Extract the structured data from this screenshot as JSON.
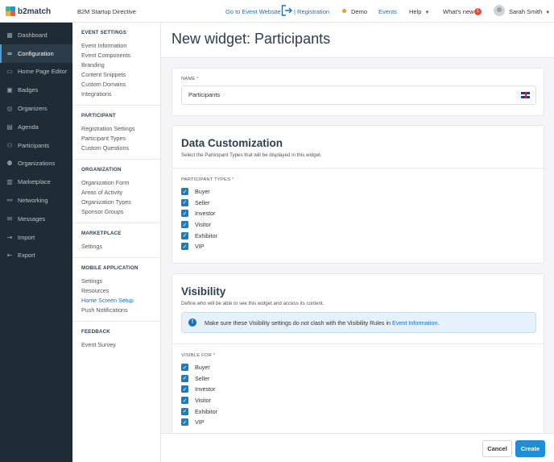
{
  "app": {
    "name": "b2match",
    "event_name": "B2M Startup Directive"
  },
  "topbar": {
    "goto_event": "Go to Event Website",
    "registration": "| Registration",
    "demo": "Demo",
    "events": "Events",
    "help": "Help",
    "whats_new": "What's new",
    "whats_new_count": "1",
    "user_name": "Sarah Smith"
  },
  "sidebar": {
    "items": [
      {
        "label": "Dashboard",
        "icon": "dashboard-icon"
      },
      {
        "label": "Configuration",
        "icon": "link-icon",
        "active": true
      },
      {
        "label": "Home Page Editor",
        "icon": "edit-icon"
      },
      {
        "label": "Badges",
        "icon": "badge-icon"
      },
      {
        "label": "Organizers",
        "icon": "organizers-icon"
      },
      {
        "label": "Agenda",
        "icon": "calendar-icon"
      },
      {
        "label": "Participants",
        "icon": "users-icon"
      },
      {
        "label": "Organizations",
        "icon": "organizations-icon"
      },
      {
        "label": "Marketplace",
        "icon": "marketplace-icon"
      },
      {
        "label": "Networking",
        "icon": "handshake-icon"
      },
      {
        "label": "Messages",
        "icon": "mail-icon"
      },
      {
        "label": "Import",
        "icon": "import-icon"
      },
      {
        "label": "Export",
        "icon": "export-icon"
      }
    ]
  },
  "submenu": {
    "sections": [
      {
        "title": "EVENT SETTINGS",
        "links": [
          "Event Information",
          "Event Components",
          "Branding",
          "Content Snippets",
          "Custom Domains",
          "Integrations"
        ]
      },
      {
        "title": "PARTICIPANT",
        "links": [
          "Registration Settings",
          "Participant Types",
          "Custom Questions"
        ]
      },
      {
        "title": "ORGANIZATION",
        "links": [
          "Organization Form",
          "Areas of Activity",
          "Organization Types",
          "Sponsor Groups"
        ]
      },
      {
        "title": "MARKETPLACE",
        "links": [
          "Settings"
        ]
      },
      {
        "title": "MOBILE APPLICATION",
        "links": [
          "Settings",
          "Resources",
          "Home Screen Setup",
          "Push Notifications"
        ]
      },
      {
        "title": "FEEDBACK",
        "links": [
          "Event Survey"
        ]
      }
    ]
  },
  "main": {
    "title": "New widget: Participants",
    "name_label": "NAME",
    "name_value": "Participants",
    "data_customization": {
      "title": "Data Customization",
      "description": "Select the Participant Types that will be displayed in this widget.",
      "types_label": "PARTICIPANT TYPES",
      "types": [
        "Buyer",
        "Seller",
        "Investor",
        "Visitor",
        "Exhibitor",
        "VIP"
      ]
    },
    "visibility": {
      "title": "Visibility",
      "description": "Define who will be able to see this widget and access its content.",
      "info_text": "Make sure these Visibility settings do not clash with the Visibility Rules in",
      "info_link": "Event Information",
      "info_end": ".",
      "visible_label": "VISIBLE FOR",
      "visible": [
        "Buyer",
        "Seller",
        "Investor",
        "Visitor",
        "Exhibitor",
        "VIP"
      ]
    }
  },
  "footer": {
    "cancel": "Cancel",
    "create": "Create"
  },
  "colors": {
    "accent": "#1d6fb8",
    "sidebar": "#1f2c35",
    "checkbox": "#1d7bc0"
  }
}
